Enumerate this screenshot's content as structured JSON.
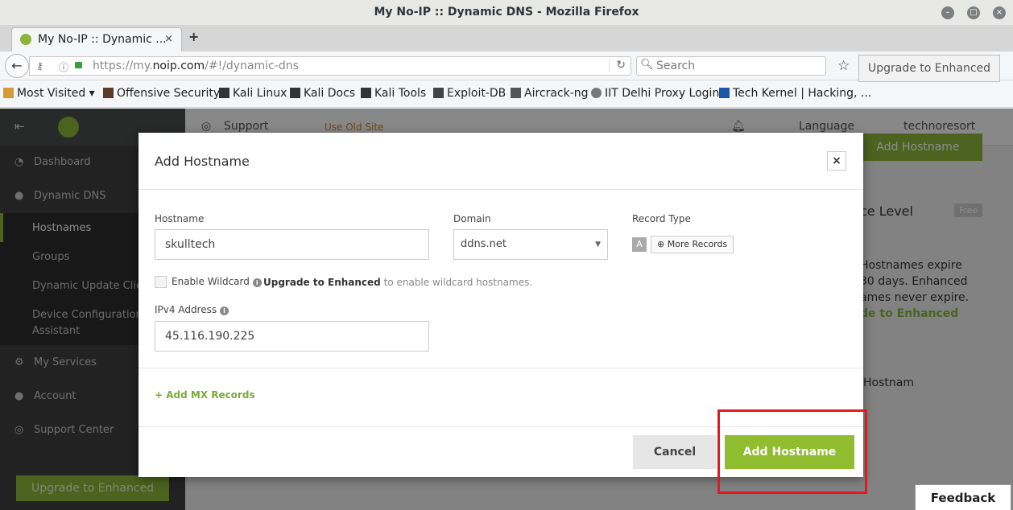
{
  "window": {
    "title": "My No-IP :: Dynamic DNS - Mozilla Firefox"
  },
  "tab": {
    "title": "My No-IP :: Dynamic ...",
    "close": "×",
    "new_tab": "+"
  },
  "navbar": {
    "back": "←",
    "url_prefix": "https://my.",
    "url_host": "noip.com",
    "url_path": "/#!/dynamic-dns",
    "reload": "↻",
    "search_placeholder": "Search"
  },
  "bookmarks": [
    {
      "label": "Most Visited ▾",
      "color": "#d89a36"
    },
    {
      "label": "Offensive Security",
      "color": "#5b3a29"
    },
    {
      "label": "Kali Linux",
      "color": "#333333"
    },
    {
      "label": "Kali Docs",
      "color": "#333333"
    },
    {
      "label": "Kali Tools",
      "color": "#333333"
    },
    {
      "label": "Exploit-DB",
      "color": "#444444"
    },
    {
      "label": "Aircrack-ng",
      "color": "#555555"
    },
    {
      "label": "IIT Delhi Proxy Login",
      "color": "#777777"
    },
    {
      "label": "Tech Kernel | Hacking, ...",
      "color": "#1c57a5"
    }
  ],
  "sidebar": {
    "items": [
      {
        "label": "Dashboard"
      },
      {
        "label": "Dynamic DNS"
      },
      {
        "label": "My Services"
      },
      {
        "label": "Account"
      },
      {
        "label": "Support Center"
      }
    ],
    "sub_items": [
      {
        "label": "Hostnames"
      },
      {
        "label": "Groups"
      },
      {
        "label": "Dynamic Update Clien"
      },
      {
        "label": "Device Configuration"
      },
      {
        "label": "Assistant"
      }
    ],
    "upgrade": "Upgrade to Enhanced"
  },
  "topnav": {
    "support": "Support",
    "old_site": "Use Old Site",
    "language": "Language",
    "user": "technoresort"
  },
  "right_panel": {
    "upgrade_button": "Upgrade to Enhanced",
    "add_button": "Add Hostname",
    "level": "ce Level",
    "free_badge": "Free",
    "text_line1": "Hostnames expire",
    "text_line2": "30 days. Enhanced",
    "text_line3": "ames never expire.",
    "text_link": "de to Enhanced",
    "hostnames": "Hostnam"
  },
  "modal": {
    "title": "Add Hostname",
    "close": "×",
    "hostname_label": "Hostname",
    "hostname_value": "skulltech",
    "domain_label": "Domain",
    "domain_value": "ddns.net",
    "record_type_label": "Record Type",
    "record_type_value": "A",
    "more_records": "More Records",
    "wildcard_label": "Enable Wildcard",
    "wildcard_link": "Upgrade to Enhanced",
    "wildcard_note": "to enable wildcard hostnames.",
    "ipv4_label": "IPv4 Address",
    "ipv4_value": "45.116.190.225",
    "add_mx": "Add MX Records",
    "cancel": "Cancel",
    "submit": "Add Hostname"
  },
  "feedback": "Feedback",
  "colors": {
    "accent": "#8fbd2f",
    "highlight": "#e11a20",
    "sidebar": "#3e3f3f"
  }
}
